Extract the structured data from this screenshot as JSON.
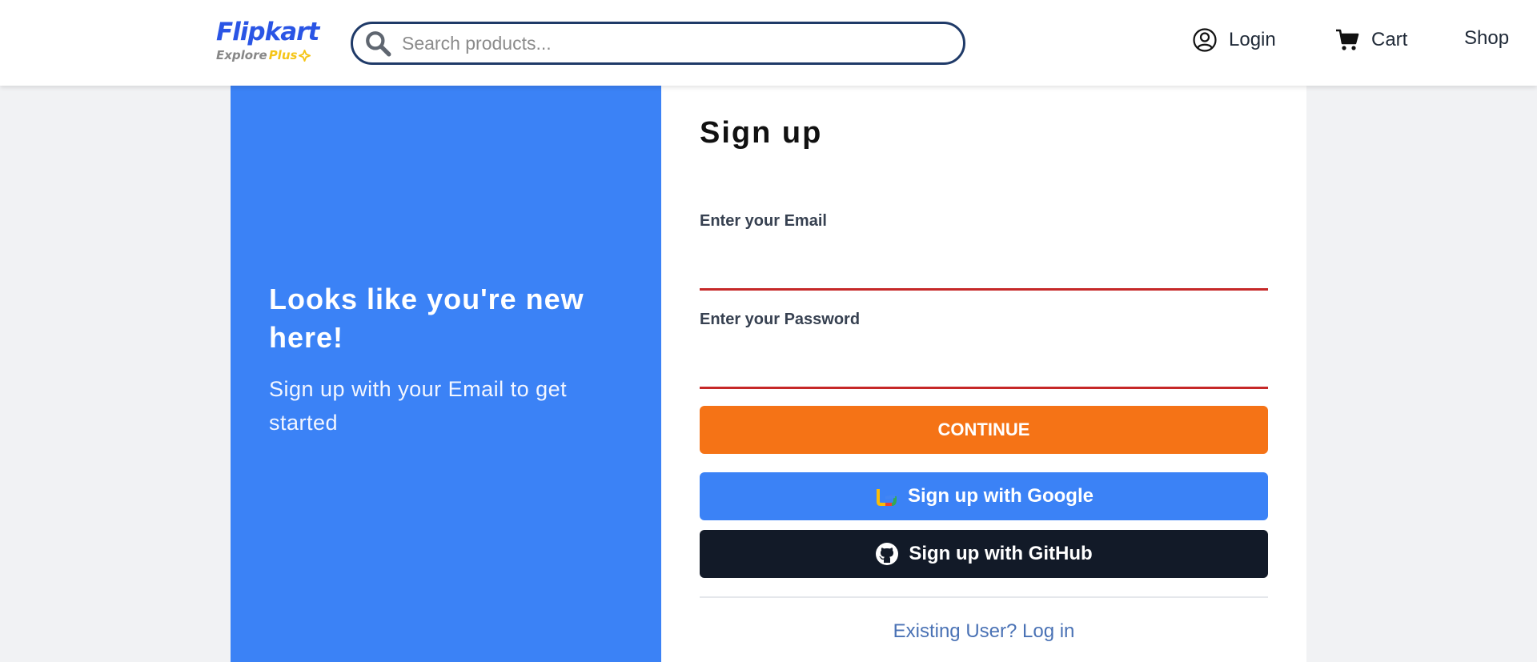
{
  "header": {
    "logo": {
      "brand": "Flipkart",
      "tagline_prefix": "Explore",
      "tagline_highlight": "Plus"
    },
    "search": {
      "placeholder": "Search products...",
      "value": ""
    },
    "nav": {
      "login": "Login",
      "cart": "Cart",
      "shop": "Shop"
    }
  },
  "promo": {
    "title": "Looks like you're new here!",
    "subtitle": "Sign up with your Email to get started"
  },
  "form": {
    "title": "Sign up",
    "email_label": "Enter your Email",
    "email_value": "",
    "password_label": "Enter your Password",
    "password_value": "",
    "continue_label": "CONTINUE",
    "google_label": "Sign up with Google",
    "github_label": "Sign up with GitHub",
    "login_link": "Existing User? Log in"
  },
  "colors": {
    "brand": "#2a55e5",
    "promo_panel": "#3b82f6",
    "continue": "#f57316",
    "google": "#3b82f6",
    "github": "#121a28",
    "input_underline": "#c62828",
    "link": "#4a72b5"
  },
  "icons": {
    "search": "search-icon",
    "login": "user-circle-icon",
    "cart": "cart-icon",
    "google": "google-icon",
    "github": "github-icon"
  }
}
